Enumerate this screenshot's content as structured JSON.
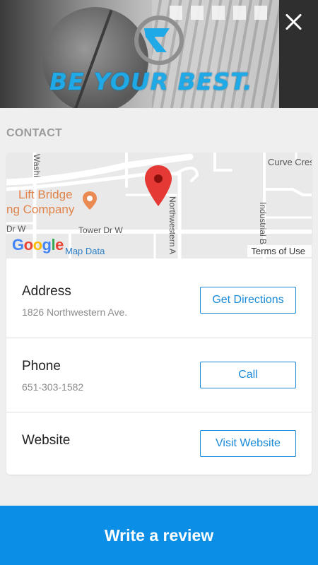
{
  "header": {
    "tagline": "BE YOUR BEST.",
    "close_icon": "close-icon"
  },
  "contact": {
    "section_title": "CONTACT",
    "map": {
      "labels": {
        "curve_crest": "Curve Crest",
        "lift_bridge_1": "Lift Bridge",
        "lift_bridge_2": "ng Company",
        "tower_dr": "Tower Dr W",
        "dr_w": "Dr W",
        "washington": "Washi",
        "northwestern": "Northwestern A",
        "industrial": "Industrial B",
        "google": "Google",
        "map_data": "Map Data",
        "terms": "Terms of Use"
      },
      "pin_color": "#e53935"
    },
    "rows": [
      {
        "name": "Address",
        "value": "1826 Northwestern Ave.",
        "action": "Get Directions"
      },
      {
        "name": "Phone",
        "value": "651-303-1582",
        "action": "Call"
      },
      {
        "name": "Website",
        "value": "",
        "action": "Visit Website"
      }
    ]
  },
  "footer": {
    "review_label": "Write a review"
  },
  "colors": {
    "accent": "#0b8ee6",
    "button_border": "#1a8ad8",
    "tagline": "#1fa9e6"
  }
}
